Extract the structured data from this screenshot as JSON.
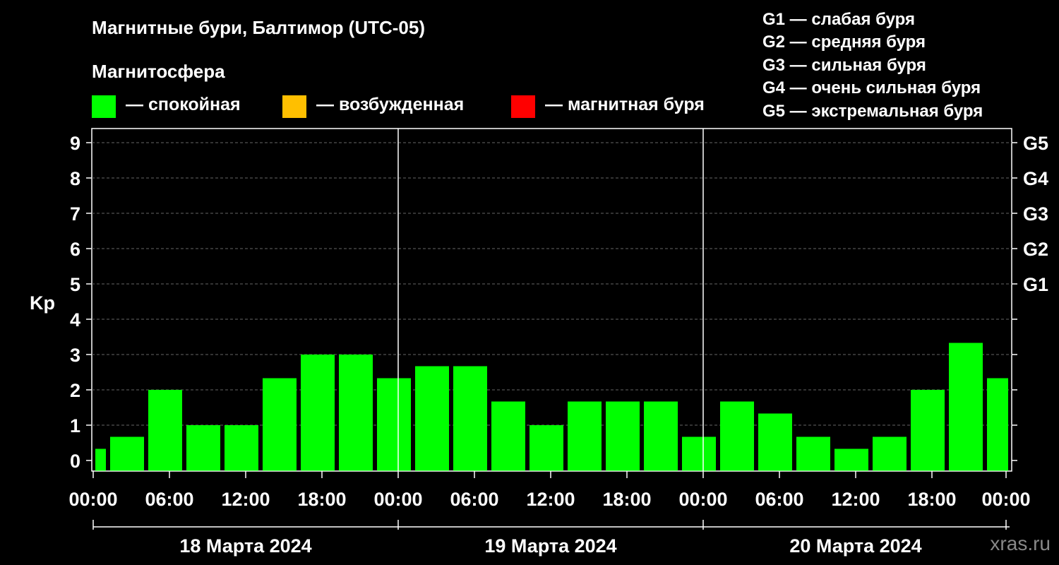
{
  "title": "Магнитные бури, Балтимор (UTC-05)",
  "legend": {
    "heading": "Магнитосфера",
    "items": [
      {
        "label": "— спокойная",
        "color": "#00ff00"
      },
      {
        "label": "— возбужденная",
        "color": "#ffbf00"
      },
      {
        "label": "— магнитная буря",
        "color": "#ff0000"
      }
    ]
  },
  "storm_levels": [
    "G1 — слабая буря",
    "G2 — средняя буря",
    "G3 — сильная буря",
    "G4 — очень сильная буря",
    "G5 — экстремальная буря"
  ],
  "site": "xras.ru",
  "chart_data": {
    "type": "bar",
    "ylabel": "Kp",
    "ylim": [
      0,
      9
    ],
    "yticks": [
      0,
      1,
      2,
      3,
      4,
      5,
      6,
      7,
      8,
      9
    ],
    "right_ticks": [
      {
        "value": 5,
        "label": "G1"
      },
      {
        "value": 6,
        "label": "G2"
      },
      {
        "value": 7,
        "label": "G3"
      },
      {
        "value": 8,
        "label": "G4"
      },
      {
        "value": 9,
        "label": "G5"
      }
    ],
    "xtick_labels": [
      "00:00",
      "06:00",
      "12:00",
      "18:00",
      "00:00",
      "06:00",
      "12:00",
      "18:00",
      "00:00",
      "06:00",
      "12:00",
      "18:00",
      "00:00"
    ],
    "days": [
      "18 Марта 2024",
      "19 Марта 2024",
      "20 Марта 2024"
    ],
    "bar_color": "#00ff00",
    "grid": true,
    "values": [
      0.33,
      0.67,
      2.0,
      1.0,
      1.0,
      2.33,
      3.0,
      3.0,
      2.33,
      2.67,
      2.67,
      1.67,
      1.0,
      1.67,
      1.67,
      1.67,
      0.67,
      1.67,
      1.33,
      0.67,
      0.33,
      0.67,
      2.0,
      3.33,
      2.33
    ]
  }
}
